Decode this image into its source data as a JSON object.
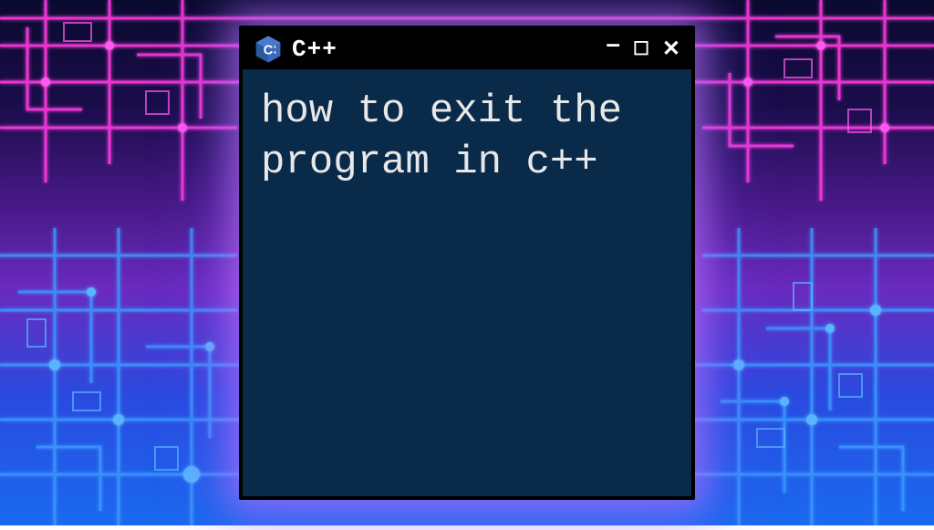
{
  "window": {
    "title": "C++",
    "icon_name": "cpp-icon"
  },
  "terminal": {
    "content": "how to exit the program in c++"
  },
  "colors": {
    "terminal_bg": "#0a2a4a",
    "titlebar_bg": "#000000",
    "text": "#e8e8e8",
    "glow": "#c878ff"
  }
}
